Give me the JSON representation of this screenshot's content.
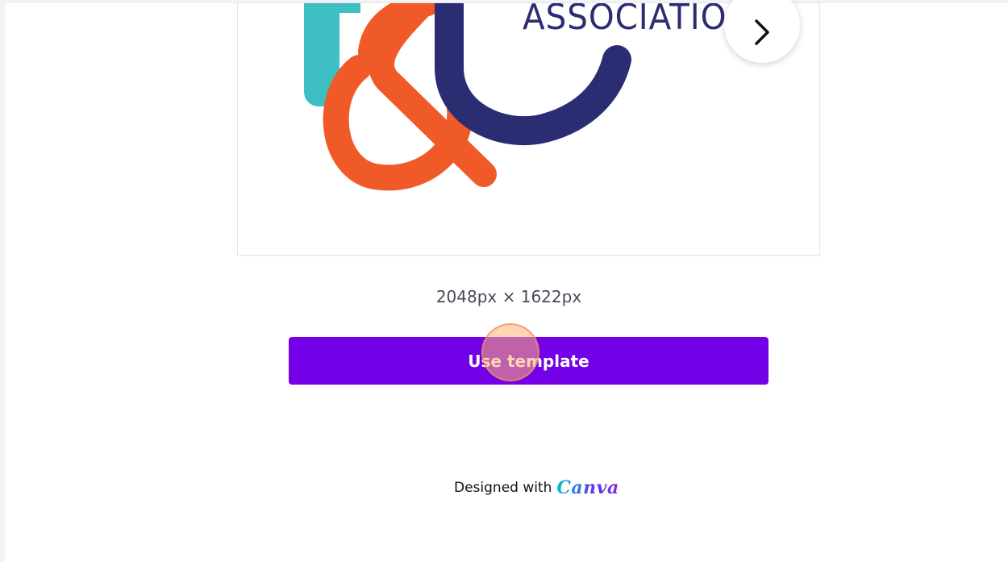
{
  "preview": {
    "artwork_text": "ASSOCIATIO",
    "next_icon": "chevron-right-icon"
  },
  "dimensions": {
    "text": "2048px × 1622px"
  },
  "actions": {
    "use_template_label": "Use template"
  },
  "footer": {
    "designed_with_label": "Designed with",
    "brand_logo": "Canva"
  },
  "colors": {
    "accent": "#7300e6",
    "teal": "#3ebfc3",
    "orange": "#f05a28",
    "navy": "#2b2d72"
  }
}
